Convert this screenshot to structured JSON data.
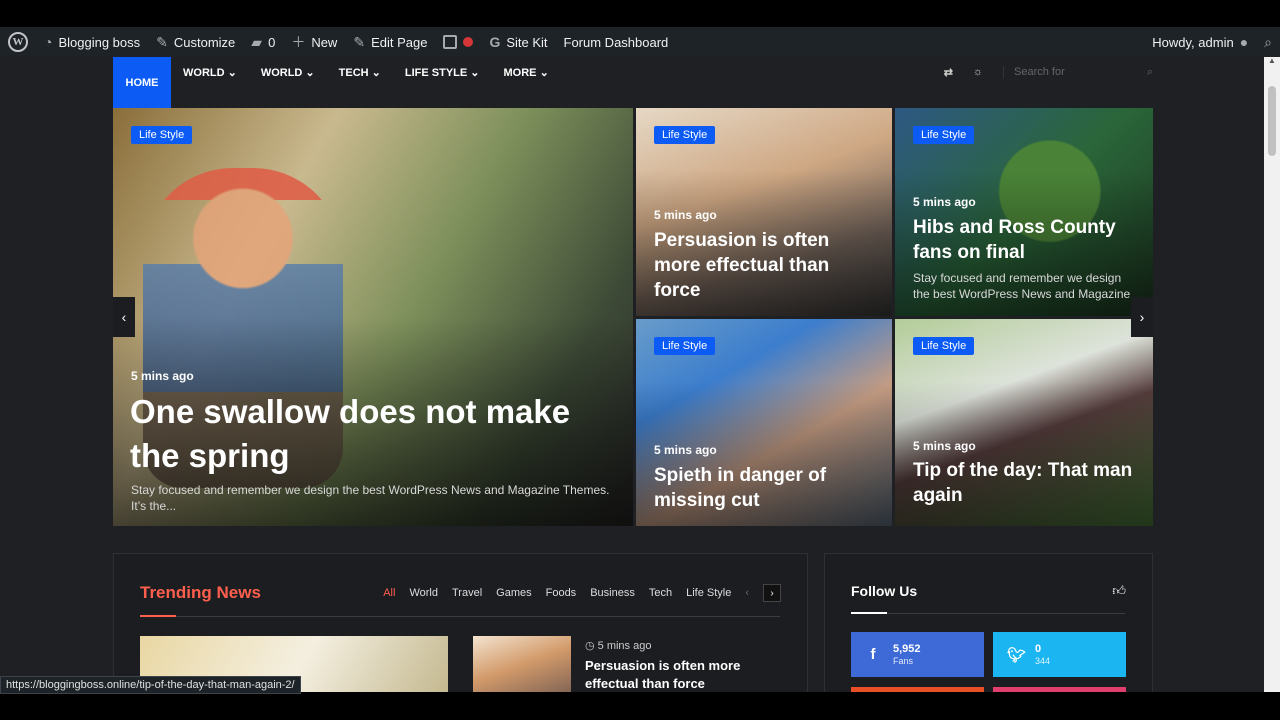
{
  "admin_bar": {
    "site_name": "Blogging boss",
    "customize": "Customize",
    "comments_count": "0",
    "new": "New",
    "edit_page": "Edit Page",
    "site_kit": "Site Kit",
    "forum_dashboard": "Forum Dashboard",
    "howdy": "Howdy, admin"
  },
  "nav": {
    "items": [
      "HOME",
      "WORLD",
      "WORLD",
      "TECH",
      "LIFE STYLE",
      "MORE"
    ],
    "search_placeholder": "Search for"
  },
  "hero": {
    "cards": [
      {
        "badge": "Life Style",
        "time": "5 mins ago",
        "title": "One swallow does not make the spring",
        "excerpt": "Stay focused and remember we design the best WordPress News and Magazine Themes. It’s the..."
      },
      {
        "badge": "Life Style",
        "time": "5 mins ago",
        "title": "Persuasion is often more effectual than force",
        "excerpt": ""
      },
      {
        "badge": "Life Style",
        "time": "5 mins ago",
        "title": "Hibs and Ross County fans on final",
        "excerpt": "Stay focused and remember we design the best WordPress News and Magazine"
      },
      {
        "badge": "Life Style",
        "time": "5 mins ago",
        "title": "Spieth in danger of missing cut",
        "excerpt": ""
      },
      {
        "badge": "Life Style",
        "time": "5 mins ago",
        "title": "Tip of the day: That man again",
        "excerpt": ""
      }
    ]
  },
  "trending": {
    "title": "Trending News",
    "tabs": [
      "All",
      "World",
      "Travel",
      "Games",
      "Foods",
      "Business",
      "Tech",
      "Life Style"
    ],
    "post_time": "5 mins ago",
    "post_title": "Persuasion is often more effectual than force"
  },
  "follow": {
    "title": "Follow Us",
    "facebook": {
      "count": "5,952",
      "label": "Fans"
    },
    "twitter": {
      "count": "0",
      "label": "344"
    }
  },
  "status_url": "https://bloggingboss.online/tip-of-the-day-that-man-again-2/",
  "colors": {
    "accent_blue": "#0c5bf5",
    "accent_red": "#ff5f4d",
    "facebook": "#3d6ad6",
    "twitter": "#1bb5f1"
  }
}
